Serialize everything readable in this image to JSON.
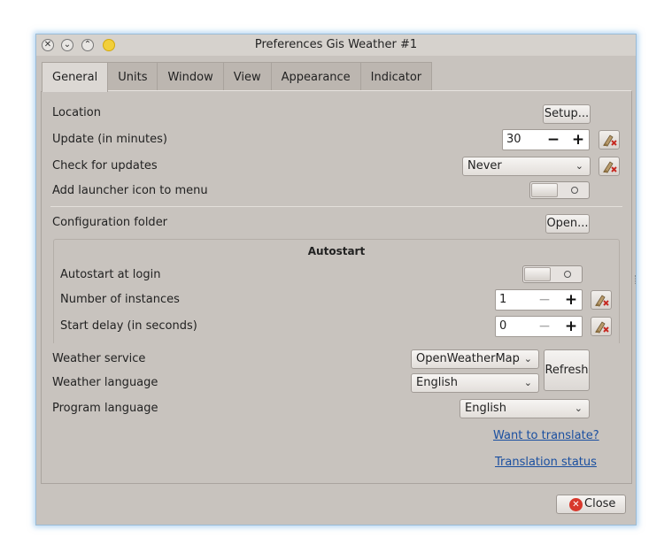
{
  "window": {
    "title": "Preferences Gis Weather #1",
    "controls": {
      "close": "✕",
      "minimize": "⌄",
      "maximize": "⌃"
    }
  },
  "tabs": [
    {
      "label": "General",
      "active": true
    },
    {
      "label": "Units"
    },
    {
      "label": "Window"
    },
    {
      "label": "View"
    },
    {
      "label": "Appearance"
    },
    {
      "label": "Indicator"
    }
  ],
  "general": {
    "location_label": "Location",
    "setup_label": "Setup...",
    "update_label": "Update (in minutes)",
    "update_value": "30",
    "check_updates_label": "Check for updates",
    "check_updates_value": "Never",
    "launcher_label": "Add launcher icon to menu",
    "config_folder_label": "Configuration folder",
    "open_label": "Open..."
  },
  "autostart": {
    "title": "Autostart",
    "login_label": "Autostart at login",
    "instances_label": "Number of instances",
    "instances_value": "1",
    "delay_label": "Start delay (in seconds)",
    "delay_value": "0"
  },
  "weather": {
    "service_label": "Weather service",
    "service_value": "OpenWeatherMap",
    "language_label": "Weather language",
    "language_value": "English",
    "refresh_label": "Refresh",
    "program_language_label": "Program language",
    "program_language_value": "English"
  },
  "links": {
    "translate": "Want to translate?",
    "status": "Translation status"
  },
  "footer": {
    "close_label": "Close"
  },
  "icons": {
    "minus": "−",
    "plus": "+",
    "chevron": "⌄",
    "close_x": "✕"
  },
  "colors": {
    "close_red": "#d8382c",
    "link_blue": "#1a4fa0",
    "window_bg": "#c8c3be"
  }
}
